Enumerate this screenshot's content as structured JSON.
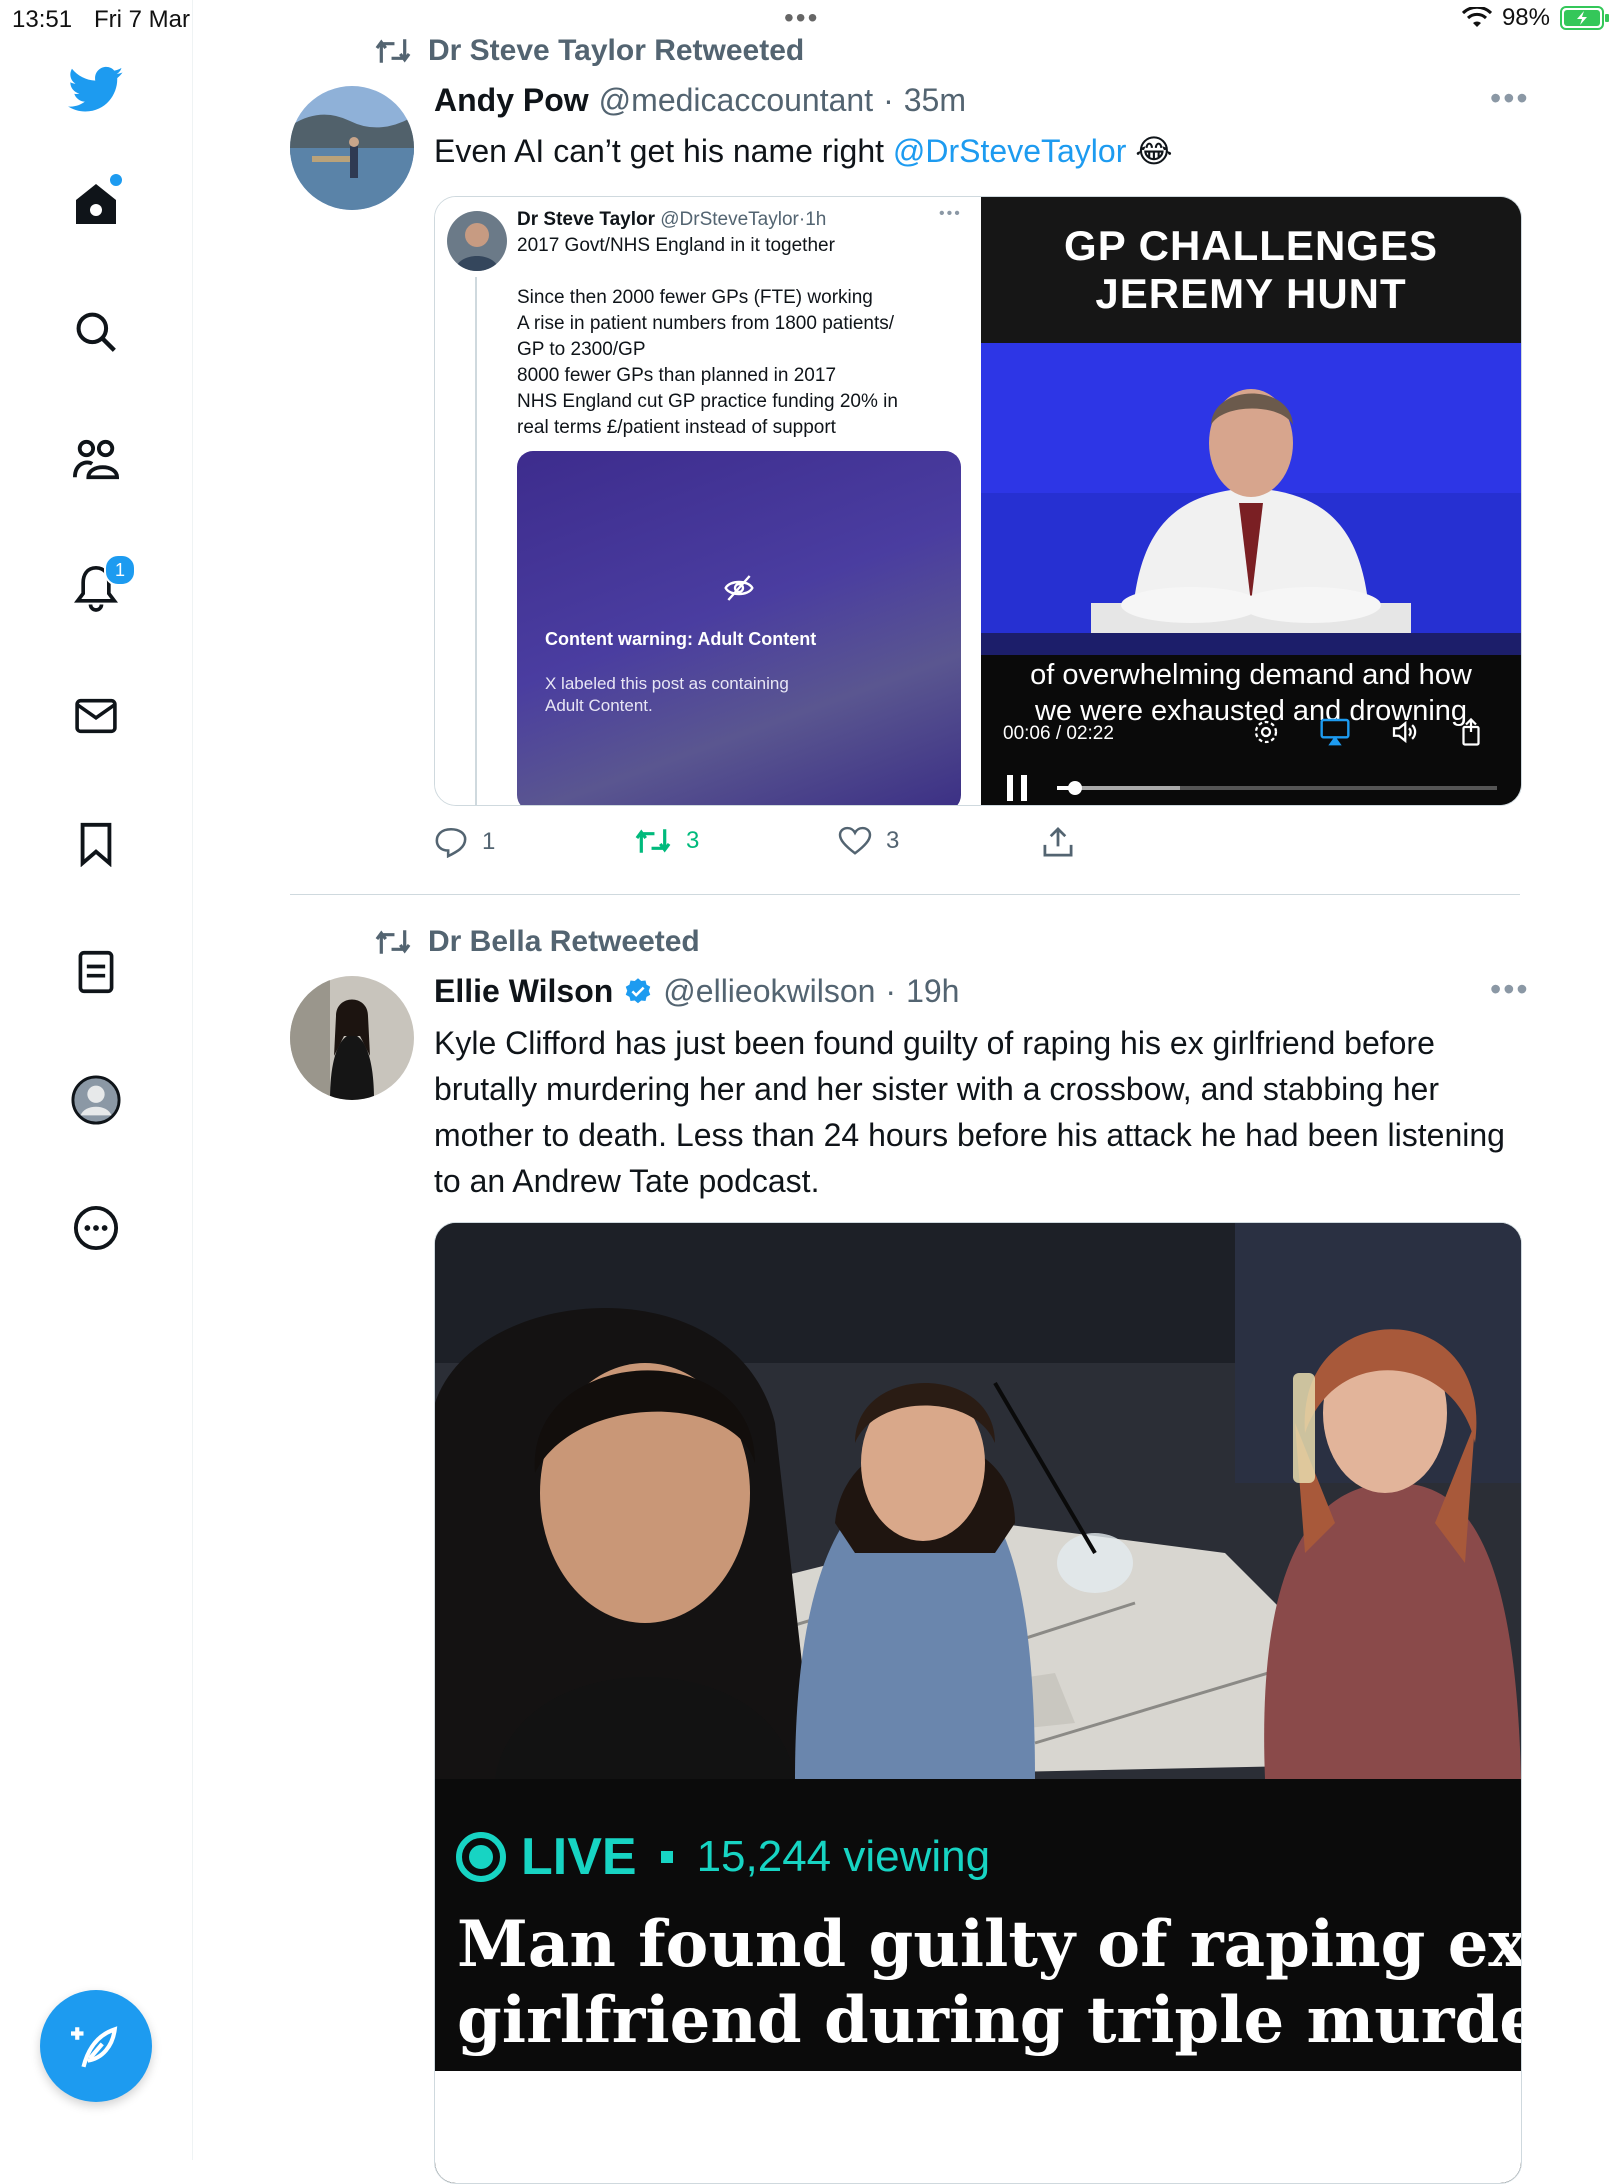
{
  "status_bar": {
    "time": "13:51",
    "date": "Fri 7 Mar",
    "battery": "98%"
  },
  "sidebar": {
    "notification_count": "1"
  },
  "tweets": [
    {
      "retweeted_by": "Dr Steve Taylor Retweeted",
      "name": "Andy Pow",
      "handle": "@medicaccountant",
      "sep": "·",
      "ago": "35m",
      "text": "Even AI can’t get his name right ",
      "mention": "@DrSteveTaylor",
      "emoji": "😂",
      "quote": {
        "name": "Dr Steve Taylor",
        "handle": "@DrSteveTaylor",
        "sep": "·",
        "ago": "1h",
        "lines": [
          "2017 Govt/NHS England in it together",
          "",
          "Since then 2000 fewer GPs (FTE) working",
          "A rise in patient numbers from 1800 patients/",
          "GP to 2300/GP",
          "8000 fewer GPs than planned in 2017",
          "NHS England cut GP practice funding 20% in",
          "real terms £/patient instead of support"
        ],
        "warning_title": "Content warning: Adult Content",
        "warning_text_1": "X labeled this post as containing",
        "warning_text_2": "Adult Content."
      },
      "video": {
        "headline_1": "GP CHALLENGES",
        "headline_2": "JEREMY HUNT",
        "caption_1": "of overwhelming demand and how",
        "caption_2": "we were exhausted and drowning",
        "time": "00:06 / 02:22",
        "progress": 0.04,
        "buffered": 0.28
      },
      "replies": "1",
      "retweets": "3",
      "likes": "3"
    },
    {
      "retweeted_by": "Dr Bella Retweeted",
      "name": "Ellie Wilson",
      "handle": "@ellieokwilson",
      "sep": "·",
      "ago": "19h",
      "text": "Kyle Clifford has just been found guilty of raping his ex girlfriend before brutally murdering her and her sister with a crossbow, and stabbing her mother to death. Less than 24 hours before his attack he had been listening to an Andrew Tate podcast.",
      "image": {
        "live": "LIVE",
        "viewing": "15,244 viewing",
        "headline_1": "Man found guilty of raping ex-",
        "headline_2": "girlfriend during triple murder"
      }
    }
  ],
  "colors": {
    "accent": "#1d9bf0",
    "retweet_green": "#00ba7c",
    "muted": "#536471"
  }
}
